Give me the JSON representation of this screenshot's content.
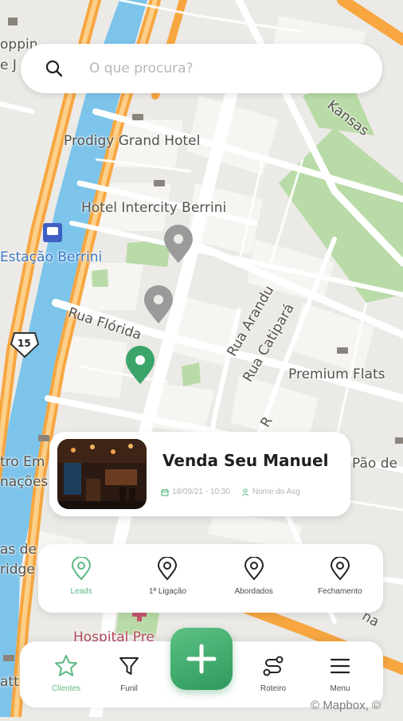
{
  "search": {
    "placeholder": "O que procura?",
    "icon": "search-icon"
  },
  "map": {
    "labels": {
      "prodigy": "Prodigy Grand Hotel",
      "intercity": "Hotel Intercity Berrini",
      "estacao": "Estação Berrini",
      "rua_florida": "Rua Flórida",
      "rua_arandu": "Rua Arandu",
      "rua_catipara": "Rua Catipará",
      "premium_flats": "Premium Flats",
      "kansas": "Kansas",
      "hospital": "Hospital Pre",
      "route_badge": "15",
      "shopping_partial": "oppin",
      "e_j_partial": "e J",
      "tro_em_partial": "tro Em",
      "nacoes_partial": "nações",
      "pao_de_partial": "Pão de",
      "as_de_partial": "as de",
      "ridge_partial": "ridge",
      "att_partial": "att",
      "r_partial": "R",
      "na_partial": "na"
    },
    "attribution": "© Mapbox, ©",
    "colors": {
      "water": "#7dc4ea",
      "park": "#b9dba7",
      "highway": "#f7a640",
      "marker_active": "#3aa46a",
      "marker_inactive": "#9a9a9a"
    }
  },
  "lead_card": {
    "title": "Venda Seu Manuel",
    "date": "18/09/21 - 10:30",
    "agent": "Nome do Asg",
    "date_icon": "calendar-icon",
    "agent_icon": "person-icon"
  },
  "stages": [
    {
      "label": "Leads",
      "icon": "map-pin-icon",
      "active": true
    },
    {
      "label": "1ª Ligação",
      "icon": "map-pin-icon",
      "active": false
    },
    {
      "label": "Abordados",
      "icon": "map-pin-icon",
      "active": false
    },
    {
      "label": "Fechamento",
      "icon": "map-pin-icon",
      "active": false
    }
  ],
  "nav": {
    "clientes": "Clientes",
    "funil": "Funil",
    "roteiro": "Roteiro",
    "menu": "Menu",
    "add_icon": "plus-icon"
  },
  "accent_color": "#5bb883"
}
